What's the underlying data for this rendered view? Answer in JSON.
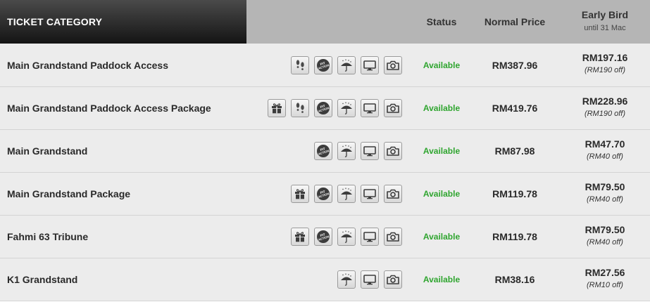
{
  "header": {
    "category": "TICKET CATEGORY",
    "status": "Status",
    "normal_price": "Normal Price",
    "early_bird": "Early Bird",
    "early_bird_until": "until 31 Mac"
  },
  "rows": [
    {
      "name": "Main Grandstand Paddock Access",
      "icons": [
        "paddock-footsteps-icon",
        "pit-action-icon",
        "rain-umbrella-icon",
        "screen-tv-icon",
        "camera-icon"
      ],
      "status": "Available",
      "price": "RM387.96",
      "early": "RM197.16",
      "off": "(RM190 off)"
    },
    {
      "name": "Main Grandstand Paddock Access Package",
      "icons": [
        "gift-package-icon",
        "paddock-footsteps-icon",
        "pit-action-icon",
        "rain-umbrella-icon",
        "screen-tv-icon",
        "camera-icon"
      ],
      "status": "Available",
      "price": "RM419.76",
      "early": "RM228.96",
      "off": "(RM190 off)"
    },
    {
      "name": "Main Grandstand",
      "icons": [
        "pit-action-icon",
        "rain-umbrella-icon",
        "screen-tv-icon",
        "camera-icon"
      ],
      "status": "Available",
      "price": "RM87.98",
      "early": "RM47.70",
      "off": "(RM40 off)"
    },
    {
      "name": "Main Grandstand Package",
      "icons": [
        "gift-package-icon",
        "pit-action-icon",
        "rain-umbrella-icon",
        "screen-tv-icon",
        "camera-icon"
      ],
      "status": "Available",
      "price": "RM119.78",
      "early": "RM79.50",
      "off": "(RM40 off)"
    },
    {
      "name": "Fahmi 63 Tribune",
      "icons": [
        "gift-package-icon",
        "pit-action-icon",
        "rain-umbrella-icon",
        "screen-tv-icon",
        "camera-icon"
      ],
      "status": "Available",
      "price": "RM119.78",
      "early": "RM79.50",
      "off": "(RM40 off)"
    },
    {
      "name": "K1 Grandstand",
      "icons": [
        "rain-umbrella-icon",
        "screen-tv-icon",
        "camera-icon"
      ],
      "status": "Available",
      "price": "RM38.16",
      "early": "RM27.56",
      "off": "(RM10 off)"
    }
  ],
  "pit_icon_text": [
    "PIT",
    "ACTION"
  ],
  "colors": {
    "available": "#2fa52f",
    "header_dark": "#1a1a1a",
    "header_gray": "#b5b5b5",
    "row_bg": "#ececec"
  }
}
